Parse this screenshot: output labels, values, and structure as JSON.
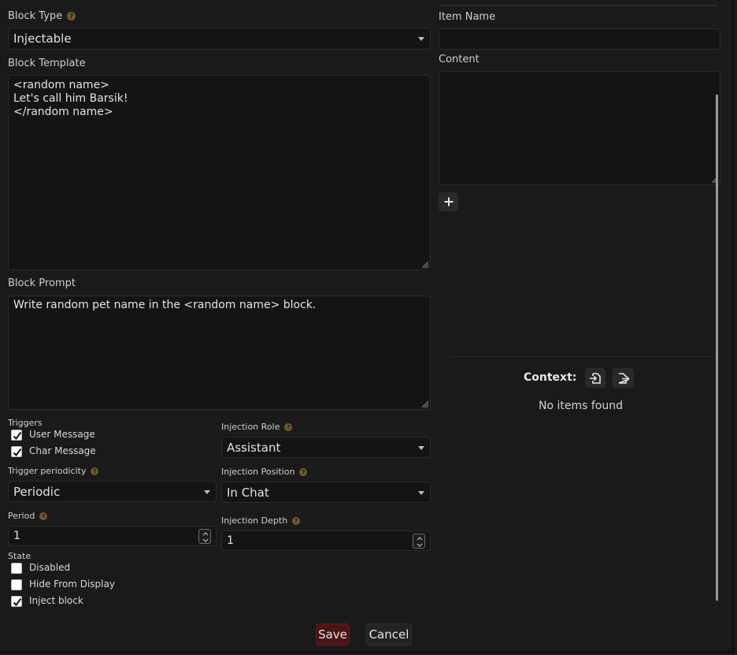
{
  "form": {
    "block_type": {
      "label": "Block Type",
      "help": "?",
      "value": "Injectable"
    },
    "block_template": {
      "label": "Block Template",
      "value": "<random name>\nLet's call him Barsik!\n</random name>"
    },
    "block_prompt": {
      "label": "Block Prompt",
      "value": "Write random pet name in the <random name> block."
    },
    "triggers": {
      "label": "Triggers",
      "items": [
        {
          "label": "User Message",
          "checked": true
        },
        {
          "label": "Char Message",
          "checked": true
        }
      ]
    },
    "trigger_periodicity": {
      "label": "Trigger periodicity",
      "help": "?",
      "value": "Periodic"
    },
    "period": {
      "label": "Period",
      "help": "?",
      "value": "1"
    },
    "injection_role": {
      "label": "Injection Role",
      "help": "?",
      "value": "Assistant"
    },
    "injection_position": {
      "label": "Injection Position",
      "help": "?",
      "value": "In Chat"
    },
    "injection_depth": {
      "label": "Injection Depth",
      "help": "?",
      "value": "1"
    },
    "state": {
      "label": "State",
      "items": [
        {
          "label": "Disabled",
          "checked": false
        },
        {
          "label": "Hide From Display",
          "checked": false
        },
        {
          "label": "Inject block",
          "checked": true
        }
      ]
    }
  },
  "right_panel": {
    "item_name": {
      "label": "Item Name",
      "value": ""
    },
    "content": {
      "label": "Content",
      "value": ""
    },
    "add_icon": "plus-icon",
    "context": {
      "label": "Context:",
      "import_icon": "file-import-icon",
      "export_icon": "file-export-icon",
      "empty_text": "No items found"
    }
  },
  "actions": {
    "save": "Save",
    "cancel": "Cancel"
  },
  "colors": {
    "background": "#1a1a1a",
    "save_button": "#4a1515",
    "help_badge": "#6e5830"
  }
}
